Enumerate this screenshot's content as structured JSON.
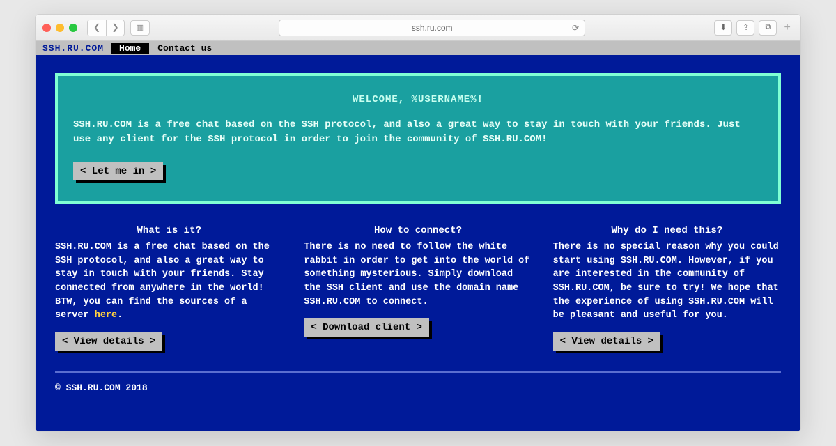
{
  "browser": {
    "url": "ssh.ru.com"
  },
  "topbar": {
    "logo": "SSH.RU.COM",
    "nav": {
      "home": "Home",
      "contact": "Contact us"
    }
  },
  "hero": {
    "title": "WELCOME, %USERNAME%!",
    "text": "SSH.RU.COM is a free chat based on the SSH protocol, and also a great way to stay in touch with your friends. Just use any client for the SSH protocol in order to join the community of SSH.RU.COM!",
    "button": "< Let me in >"
  },
  "columns": {
    "c1": {
      "title": "What is it?",
      "body_a": "SSH.RU.COM is a free chat based on the SSH protocol, and also a great way to stay in touch with your friends. Stay connected from anywhere in the world! BTW, you can find the sources of a server ",
      "link": "here",
      "body_b": ".",
      "button": "< View details >"
    },
    "c2": {
      "title": "How to connect?",
      "body": "There is no need to follow the white rabbit in order to get into the world of something mysterious. Simply download the SSH client and use the domain name SSH.RU.COM to connect.",
      "button": "< Download client >"
    },
    "c3": {
      "title": "Why do I need this?",
      "body": "There is no special reason why you could start using SSH.RU.COM. However, if you are interested in the community of SSH.RU.COM, be sure to try! We hope that the experience of using SSH.RU.COM will be pleasant and useful for you.",
      "button": "< View details >"
    }
  },
  "footer": "© SSH.RU.COM 2018"
}
